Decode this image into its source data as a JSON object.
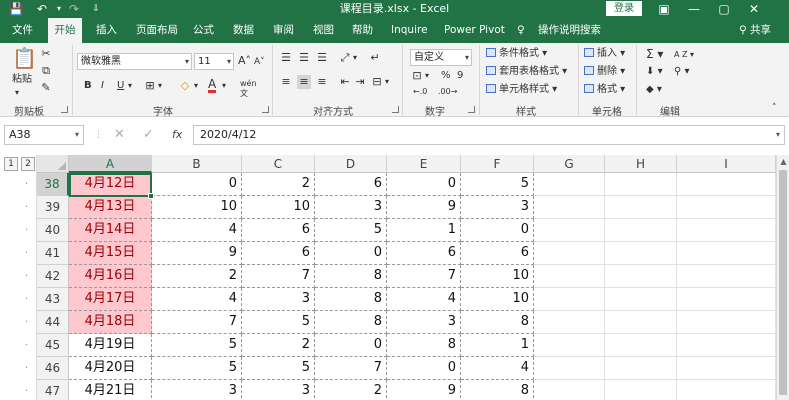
{
  "window": {
    "title": "课程目录.xlsx  -  Excel",
    "signin": "登录",
    "qat": {
      "save": "💾",
      "undo": "↶",
      "redo": "↷",
      "more": "⇩"
    }
  },
  "tabs": [
    "文件",
    "开始",
    "插入",
    "页面布局",
    "公式",
    "数据",
    "审阅",
    "视图",
    "帮助",
    "Inquire",
    "Power Pivot",
    "操作说明搜索"
  ],
  "active_tab": "开始",
  "share_label": "共享",
  "ribbon": {
    "clipboard": {
      "paste": "粘贴",
      "label": "剪贴板"
    },
    "font": {
      "name": "微软雅黑",
      "size": "11",
      "bold": "B",
      "italic": "I",
      "underline": "U",
      "grow": "A",
      "shrink": "A",
      "fontcolor": "A",
      "fill_icon": "fill-color-icon",
      "label": "字体",
      "wen": "wén"
    },
    "alignment": {
      "label": "对齐方式"
    },
    "number": {
      "format": "自定义",
      "percent": "%",
      "comma": "9",
      "label": "数字"
    },
    "styles": {
      "conditional": "条件格式",
      "table": "套用表格格式",
      "cell": "单元格样式",
      "label": "样式"
    },
    "cells": {
      "insert": "插入",
      "delete": "删除",
      "format": "格式",
      "label": "单元格"
    },
    "editing": {
      "sum": "Σ",
      "sort": "A Z",
      "label": "编辑"
    }
  },
  "formula_bar": {
    "name_box": "A38",
    "cancel": "✕",
    "enter": "✓",
    "fx": "fx",
    "value": "2020/4/12"
  },
  "outline_levels": [
    "1",
    "2"
  ],
  "columns": [
    "A",
    "B",
    "C",
    "D",
    "E",
    "F",
    "G",
    "H",
    "I"
  ],
  "selected_column": "A",
  "rows": [
    {
      "num": "38",
      "date": "4月12日",
      "b": "0",
      "c": "2",
      "d": "6",
      "e": "0",
      "f": "5",
      "highlight": true
    },
    {
      "num": "39",
      "date": "4月13日",
      "b": "10",
      "c": "10",
      "d": "3",
      "e": "9",
      "f": "3",
      "highlight": true
    },
    {
      "num": "40",
      "date": "4月14日",
      "b": "4",
      "c": "6",
      "d": "5",
      "e": "1",
      "f": "0",
      "highlight": true
    },
    {
      "num": "41",
      "date": "4月15日",
      "b": "9",
      "c": "6",
      "d": "0",
      "e": "6",
      "f": "6",
      "highlight": true
    },
    {
      "num": "42",
      "date": "4月16日",
      "b": "2",
      "c": "7",
      "d": "8",
      "e": "7",
      "f": "10",
      "highlight": true
    },
    {
      "num": "43",
      "date": "4月17日",
      "b": "4",
      "c": "3",
      "d": "8",
      "e": "4",
      "f": "10",
      "highlight": true
    },
    {
      "num": "44",
      "date": "4月18日",
      "b": "7",
      "c": "5",
      "d": "8",
      "e": "3",
      "f": "8",
      "highlight": true
    },
    {
      "num": "45",
      "date": "4月19日",
      "b": "5",
      "c": "2",
      "d": "0",
      "e": "8",
      "f": "1",
      "highlight": false
    },
    {
      "num": "46",
      "date": "4月20日",
      "b": "5",
      "c": "5",
      "d": "7",
      "e": "0",
      "f": "4",
      "highlight": false
    },
    {
      "num": "47",
      "date": "4月21日",
      "b": "3",
      "c": "3",
      "d": "2",
      "e": "9",
      "f": "8",
      "highlight": false
    }
  ],
  "colors": {
    "accent": "#217346",
    "highlight_fill": "#ffc7ce",
    "highlight_text": "#9c0006"
  }
}
